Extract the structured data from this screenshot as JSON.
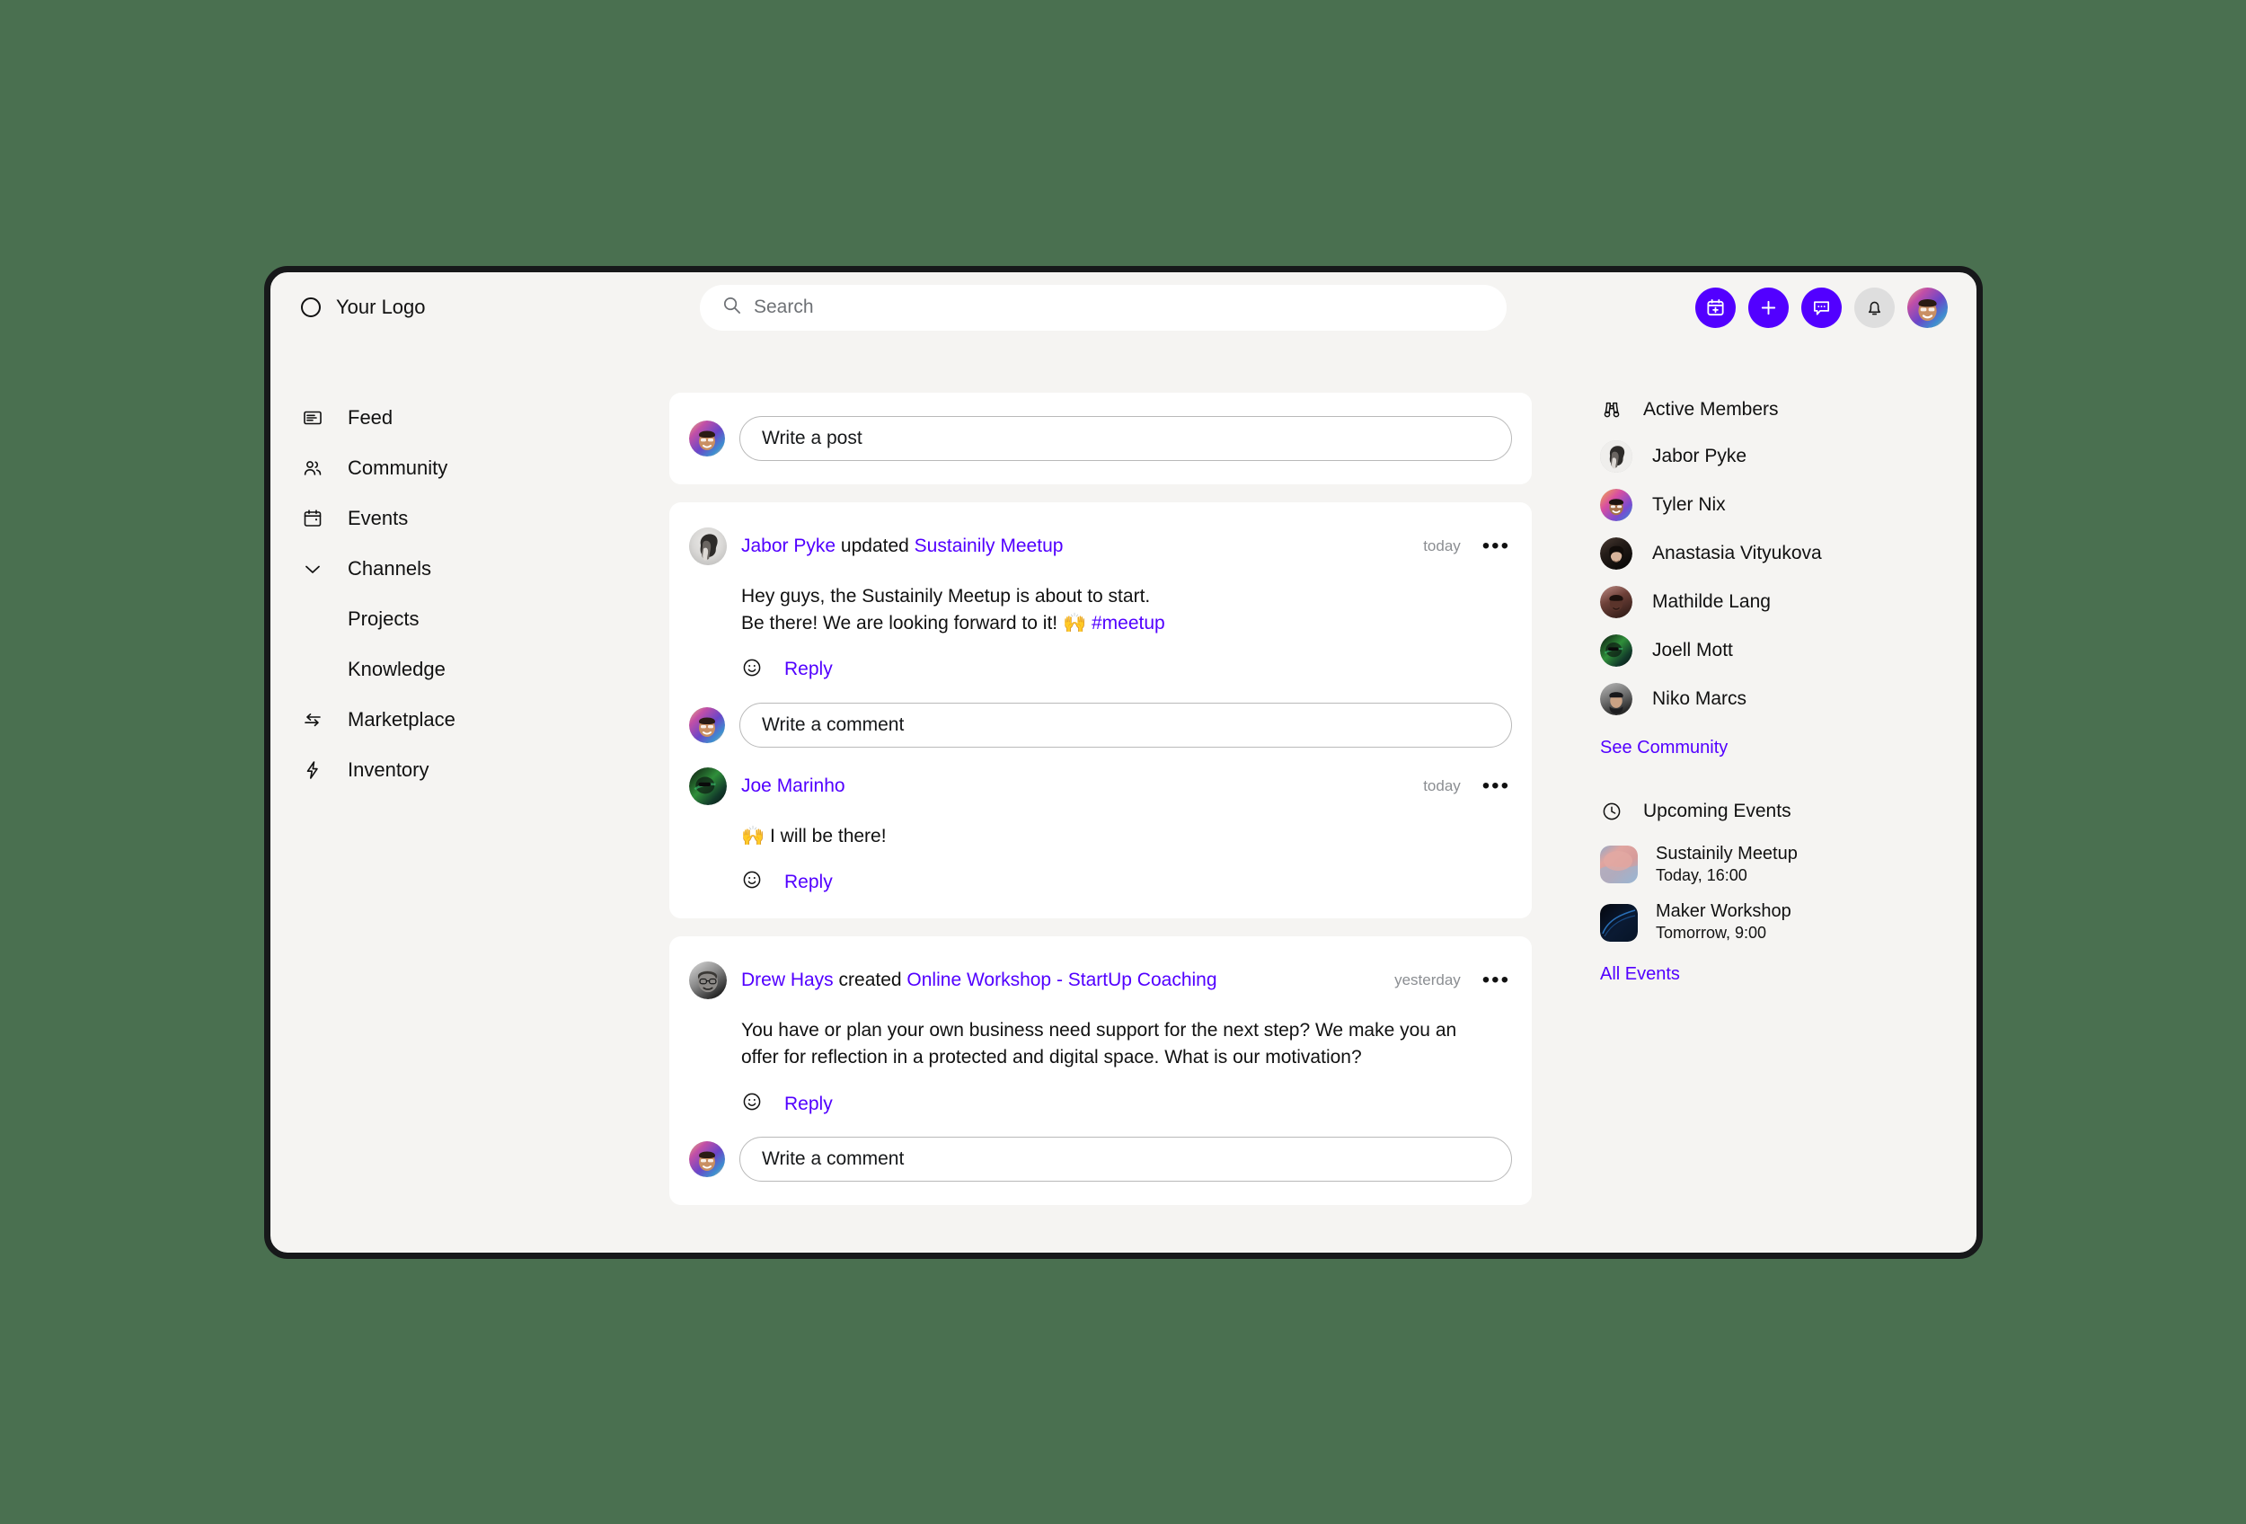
{
  "brand": {
    "name": "Your Logo",
    "logo_icon": "circle-logo-icon",
    "accent": "#5200ff"
  },
  "search": {
    "placeholder": "Search",
    "value": "",
    "icon": "search-icon"
  },
  "top_actions": [
    {
      "name": "create-event-button",
      "icon": "calendar-plus-icon",
      "style": "accent"
    },
    {
      "name": "create-button",
      "icon": "plus-icon",
      "style": "accent"
    },
    {
      "name": "messages-button",
      "icon": "chat-bubble-icon",
      "style": "accent"
    },
    {
      "name": "notifications-button",
      "icon": "bell-icon",
      "style": "grey"
    }
  ],
  "header_avatar": {
    "name": "user-avatar",
    "alt": "Your profile"
  },
  "sidebar": {
    "items": [
      {
        "label": "Feed",
        "icon": "feed-icon",
        "sub": false
      },
      {
        "label": "Community",
        "icon": "people-icon",
        "sub": false
      },
      {
        "label": "Events",
        "icon": "calendar-icon",
        "sub": false
      },
      {
        "label": "Channels",
        "icon": "chevron-down-icon",
        "sub": false
      },
      {
        "label": "Projects",
        "icon": "",
        "sub": true
      },
      {
        "label": "Knowledge",
        "icon": "",
        "sub": true
      },
      {
        "label": "Marketplace",
        "icon": "exchange-icon",
        "sub": false
      },
      {
        "label": "Inventory",
        "icon": "bolt-icon",
        "sub": false
      }
    ]
  },
  "composer": {
    "placeholder": "Write a post",
    "value": ""
  },
  "posts": [
    {
      "author": "Jabor Pyke",
      "action": "updated",
      "target": "Sustainily Meetup",
      "timestamp": "today",
      "menu_icon": "more-options-icon",
      "body_line1": "Hey guys, the Sustainily Meetup is about to start.",
      "body_line2": "Be there! We are looking forward to it!",
      "body_emoji": "🙌",
      "hashtag": "#meetup",
      "reply_label": "Reply",
      "reaction_icon": "smiley-icon",
      "comment_placeholder": "Write a comment",
      "comment_value": "",
      "comments": [
        {
          "author": "Joe Marinho",
          "timestamp": "today",
          "menu_icon": "more-options-icon",
          "emoji": "🙌",
          "text": "I will be there!",
          "reply_label": "Reply",
          "reaction_icon": "smiley-icon"
        }
      ]
    },
    {
      "author": "Drew Hays",
      "action": "created",
      "target": "Online Workshop - StartUp Coaching",
      "timestamp": "yesterday",
      "menu_icon": "more-options-icon",
      "body_line1": "You have or plan your own business need support for the next step? We make you an",
      "body_line2": "offer for reflection in a protected and digital space. What is our motivation?",
      "body_emoji": "",
      "hashtag": "",
      "reply_label": "Reply",
      "reaction_icon": "smiley-icon",
      "comment_placeholder": "Write a comment",
      "comment_value": "",
      "comments": []
    }
  ],
  "right_rail": {
    "members_title": "Active Members",
    "members_icon": "binoculars-icon",
    "members": [
      {
        "name": "Jabor Pyke"
      },
      {
        "name": "Tyler Nix"
      },
      {
        "name": "Anastasia Vityukova"
      },
      {
        "name": "Mathilde Lang"
      },
      {
        "name": "Joell Mott"
      },
      {
        "name": "Niko Marcs"
      }
    ],
    "see_community_label": "See Community",
    "events_title": "Upcoming Events",
    "events_icon": "clock-icon",
    "events": [
      {
        "name": "Sustainily Meetup",
        "time": "Today, 16:00",
        "thumb": "pink"
      },
      {
        "name": "Maker Workshop",
        "time": "Tomorrow, 9:00",
        "thumb": "dark"
      }
    ],
    "all_events_label": "All Events"
  }
}
